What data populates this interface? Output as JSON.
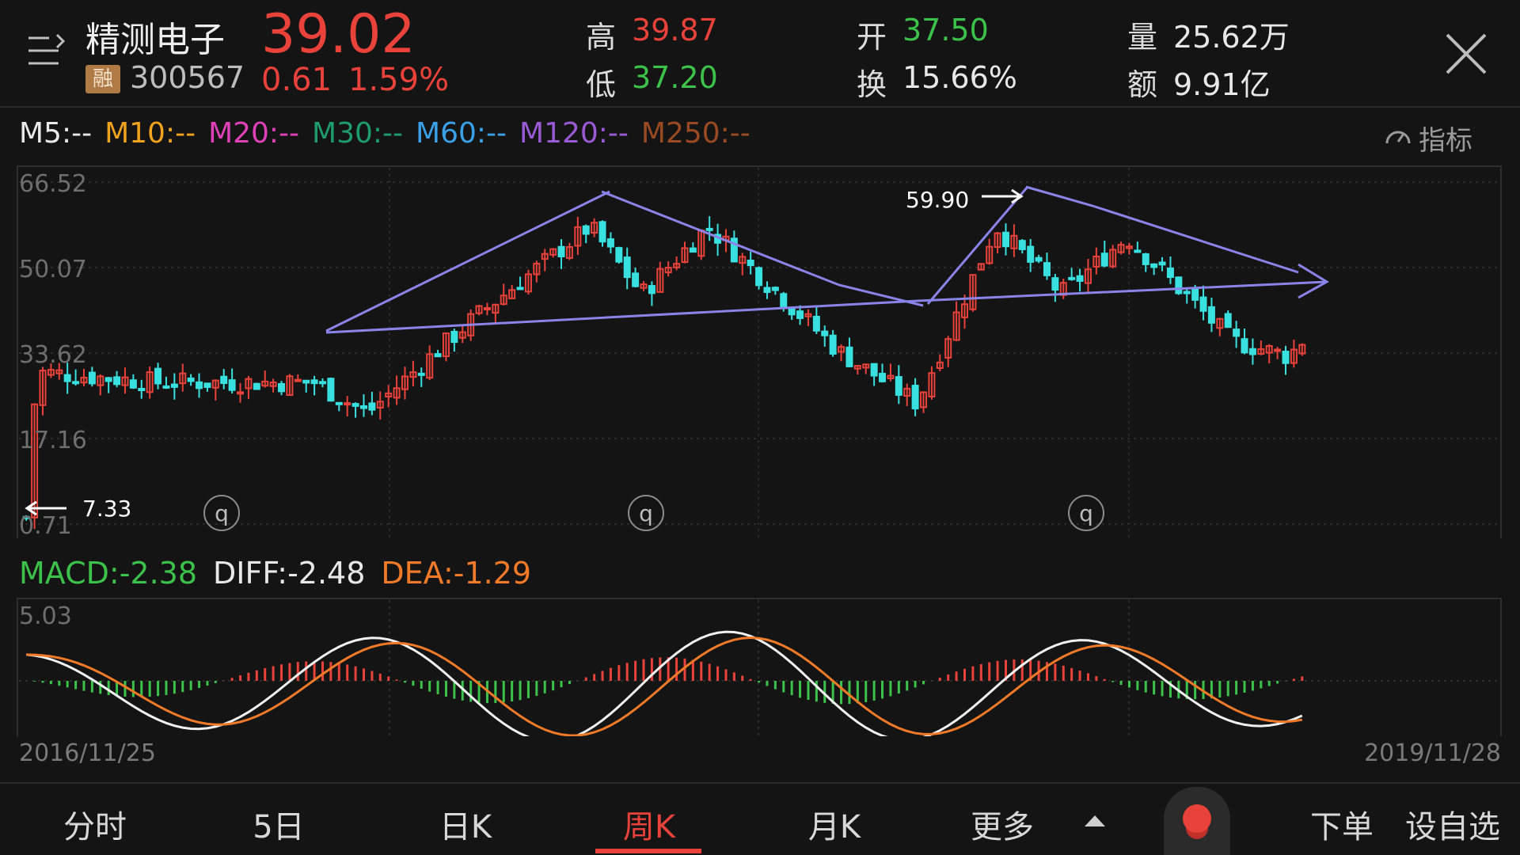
{
  "header": {
    "stock_name": "精测电子",
    "badge": "融",
    "stock_code": "300567",
    "price": "39.02",
    "change": "0.61",
    "change_pct": "1.59%",
    "high_label": "高",
    "high": "39.87",
    "low_label": "低",
    "low": "37.20",
    "open_label": "开",
    "open": "37.50",
    "turnover_label": "换",
    "turnover": "15.66%",
    "volume_label": "量",
    "volume": "25.62万",
    "amount_label": "额",
    "amount": "9.91亿"
  },
  "ma_legend": [
    {
      "label": "M5:--",
      "color": "#e8e8e8"
    },
    {
      "label": "M10:--",
      "color": "#f0a31c"
    },
    {
      "label": "M20:--",
      "color": "#e040b8"
    },
    {
      "label": "M30:--",
      "color": "#1e9c6c"
    },
    {
      "label": "M60:--",
      "color": "#3aa0e8"
    },
    {
      "label": "M120:--",
      "color": "#9a5ad6"
    },
    {
      "label": "M250:--",
      "color": "#9a4a22"
    }
  ],
  "indicator_label": "指标",
  "chart_data": {
    "type": "candlestick",
    "y_ticks": [
      "66.52",
      "50.07",
      "33.62",
      "17.16",
      "0.71"
    ],
    "ylim": [
      0.71,
      66.52
    ],
    "x_start": "2016/11/25",
    "x_end": "2019/11/28",
    "annotations": [
      "59.90",
      "7.33"
    ],
    "event_markers": [
      "q",
      "q",
      "q"
    ],
    "macd": {
      "label": "MACD:-2.38",
      "diff": "DIFF:-2.48",
      "dea": "DEA:-1.29",
      "top_tick": "5.03"
    },
    "colors": {
      "up": "#e8423a",
      "down": "#38e0e0",
      "trend": "#8a84e8",
      "diff": "#f0f0f0",
      "dea": "#f07a28",
      "macd_pos": "#e8423a",
      "macd_neg": "#3cc24a"
    }
  },
  "tabs": [
    {
      "label": "分时"
    },
    {
      "label": "5日"
    },
    {
      "label": "日K"
    },
    {
      "label": "周K",
      "active": true
    },
    {
      "label": "月K"
    },
    {
      "label": "更多"
    }
  ],
  "actions": {
    "order": "下单",
    "watchlist": "设自选"
  }
}
